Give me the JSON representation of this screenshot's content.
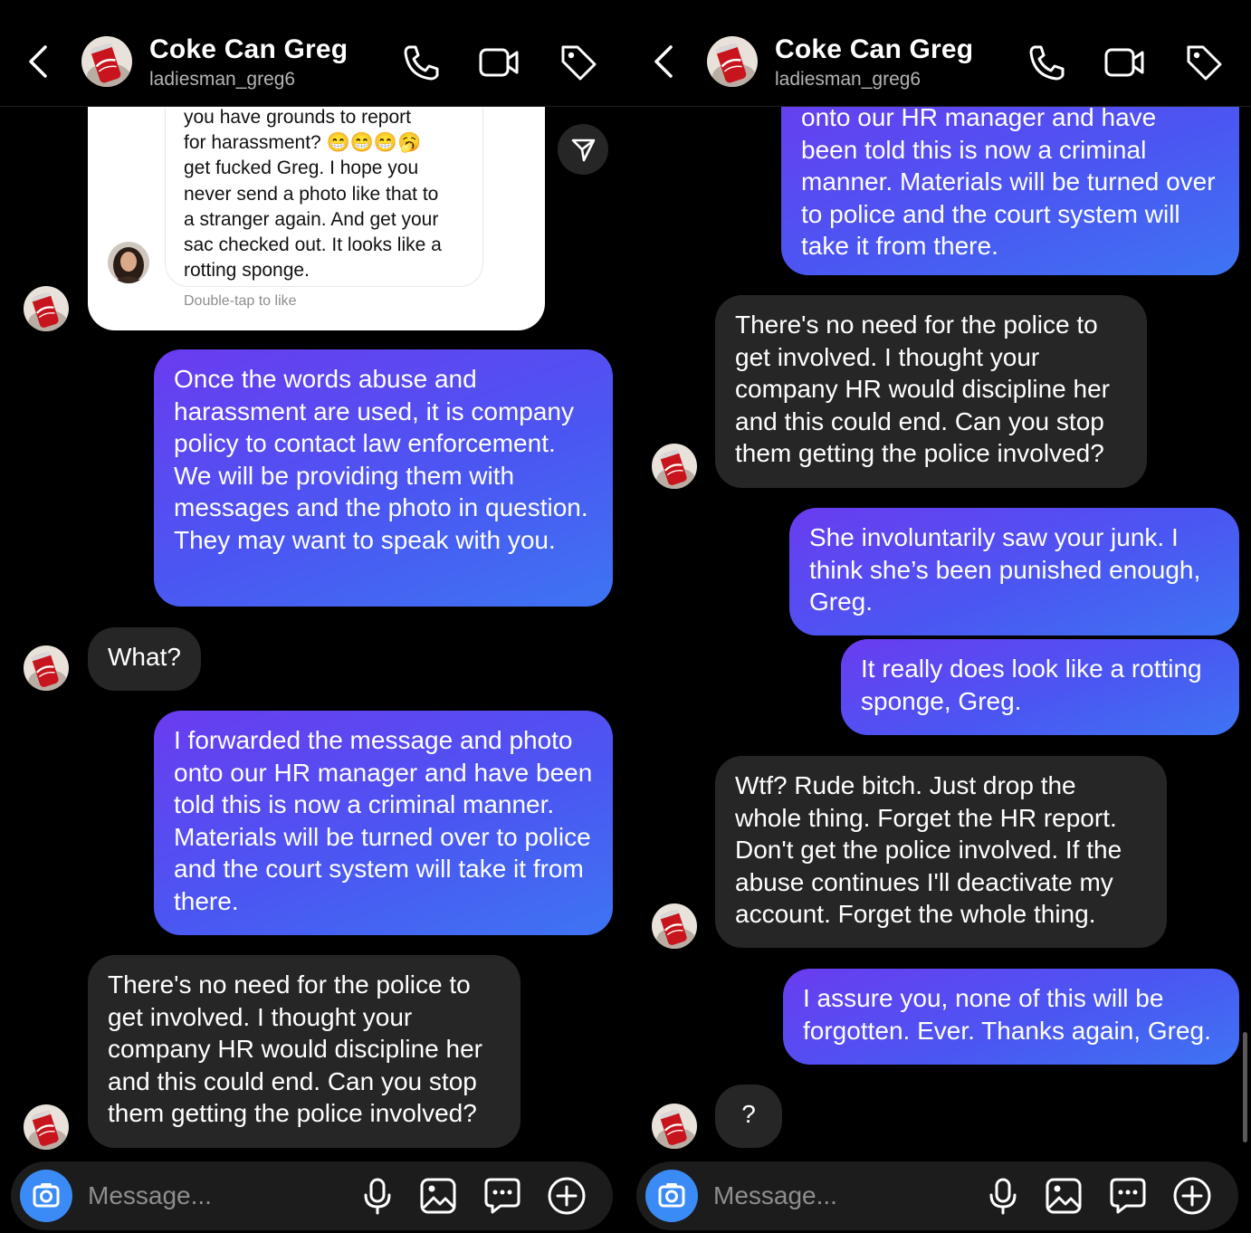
{
  "header": {
    "name": "Coke Can Greg",
    "username": "ladiesman_greg6"
  },
  "left": {
    "shared_card": {
      "lines": [
        "you have grounds to report",
        "for harassment? 😁😁😁🥱",
        "get fucked Greg. I hope you",
        "never send a photo like that to",
        "a stranger again. And get your",
        "sac checked out. It looks like a",
        "rotting sponge."
      ],
      "double_tap": "Double-tap to like"
    },
    "messages": [
      {
        "type": "sent",
        "text": "Once the words abuse and harassment are used, it is company policy to contact law enforcement. We will be providing them with messages and the photo in question. They may want to speak with you."
      },
      {
        "type": "received",
        "text": "What?"
      },
      {
        "type": "sent",
        "text": "I forwarded the message and photo onto our HR manager and have been told this is now a criminal manner. Materials will be turned over to police and the court system will take it from there."
      },
      {
        "type": "received",
        "text": "There's no need for the police to get involved. I thought your company HR would discipline her and this could end. Can you stop them getting the police involved?"
      }
    ]
  },
  "right": {
    "messages": [
      {
        "type": "sent",
        "text": "onto our HR manager and have been told this is now a criminal manner. Materials will be turned over to police and the court system will take it from there."
      },
      {
        "type": "received",
        "text": "There's no need for the police to get involved. I thought your company HR would discipline her and this could end. Can you stop them getting the police involved?"
      },
      {
        "type": "sent",
        "text": "She involuntarily saw your junk. I think she’s been punished enough, Greg."
      },
      {
        "type": "sent",
        "text": "It really does look like a rotting sponge, Greg."
      },
      {
        "type": "received",
        "text": "Wtf? Rude bitch. Just drop the whole thing. Forget the HR report. Don't get the police involved. If the abuse continues I'll deactivate my account. Forget the whole thing."
      },
      {
        "type": "sent",
        "text": "I assure you, none of this will be forgotten. Ever. Thanks again, Greg."
      },
      {
        "type": "received",
        "text": "?"
      }
    ]
  },
  "composer": {
    "placeholder": "Message..."
  },
  "icons": [
    "back-chevron-icon",
    "phone-icon",
    "video-camera-icon",
    "tag-icon",
    "camera-icon",
    "microphone-icon",
    "gallery-icon",
    "sticker-chat-icon",
    "plus-icon",
    "share-paper-plane-icon"
  ],
  "colors": {
    "sent_top": "#6a3cf0",
    "sent_bottom": "#3e74f3",
    "received": "#262626",
    "camera_button": "#3a8bf6"
  }
}
